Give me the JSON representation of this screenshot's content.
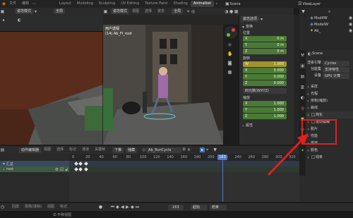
{
  "menu": {
    "file": "文件",
    "edit": "编辑",
    "tabs": [
      "Layout",
      "Modeling",
      "Sculpting",
      "UV Editing",
      "Texture Paint",
      "Shading",
      "Animation"
    ],
    "active_tab": "Animation",
    "scene": "Scene",
    "view_layer": "ViewLayer"
  },
  "left_view": {
    "mode": "姿态模式",
    "transform": "全局"
  },
  "viewport": {
    "mode": "姿态模式",
    "menu": [
      "视图",
      "选择",
      "姿态"
    ],
    "transform": "全局",
    "overlay_title": "用户透视",
    "overlay_sub": "(14) Ab_Fl_root"
  },
  "npanel": {
    "header": "姿态选项",
    "transform": "变换",
    "location_label": "位置",
    "location": [
      {
        "axis": "X",
        "value": "0 m"
      },
      {
        "axis": "Y",
        "value": "0 m"
      },
      {
        "axis": "Z",
        "value": "0 m"
      }
    ],
    "rotation_label": "旋转",
    "rotation": [
      {
        "axis": "W",
        "value": "1.000"
      },
      {
        "axis": "X",
        "value": "0.000"
      },
      {
        "axis": "Y",
        "value": "0.000"
      },
      {
        "axis": "Z",
        "value": "0.000"
      }
    ],
    "rotation_mode": "四元数(WXYZ)",
    "scale_label": "缩放",
    "scale": [
      {
        "axis": "X",
        "value": "1.000"
      },
      {
        "axis": "Y",
        "value": "1.000"
      },
      {
        "axis": "Z",
        "value": "1.000"
      }
    ],
    "attributes": "属性"
  },
  "outliner": {
    "items": [
      "ModifW",
      "ModelW",
      "Ab_"
    ]
  },
  "properties": {
    "scene": "Scene",
    "engine_label": "渲染引擎",
    "engine": "Cycles",
    "feature_label": "功能集",
    "feature": "支持特性",
    "device_label": "设备",
    "device": "GPU 计算",
    "sections": [
      "采样",
      "光程",
      "体积(缩放)",
      "曲线",
      "简化",
      "运动模糊",
      "胶片",
      "性能",
      "烘焙",
      "颜色",
      "线条"
    ],
    "highlighted_section": "简化"
  },
  "dopesheet": {
    "mode": "动作编辑器",
    "menu": [
      "视图",
      "选择",
      "标记",
      "通道",
      "关键帧"
    ],
    "push": "下推",
    "stash": "储藏",
    "action": "Ab_RunCycle",
    "summary": "汇总",
    "channel": "root",
    "frames": [
      "0",
      "20",
      "40",
      "60",
      "80",
      "100",
      "120",
      "140",
      "160",
      "180",
      "200",
      "220",
      "240",
      "260",
      "280",
      "300",
      "320",
      "340"
    ],
    "current_frame": "163"
  },
  "playback": {
    "playback": "回放",
    "keying": "抠像(插帧)",
    "view": "视图",
    "marker": "标记",
    "frame": "163",
    "start": "起始",
    "end": "结束",
    "status": "平移视图"
  },
  "colors": {
    "accent_blue": "#4772b3",
    "current_frame": "#4f7bc4",
    "highlight_red": "#e0201c",
    "field_green": "#4a7a36",
    "field_yellow": "#a0942c"
  }
}
